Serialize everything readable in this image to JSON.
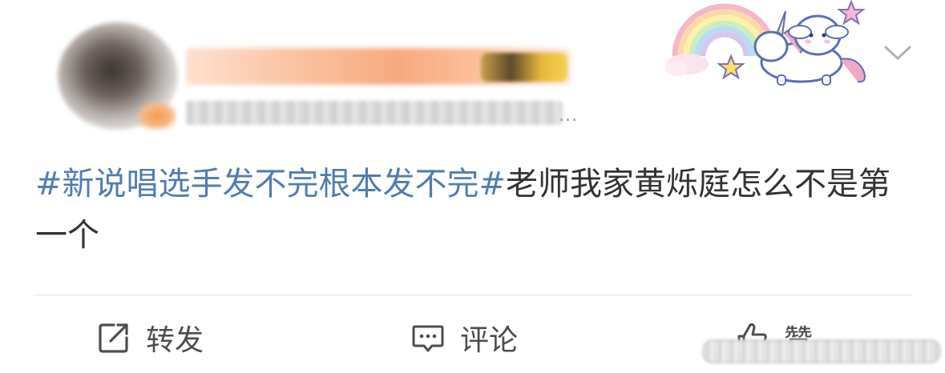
{
  "header": {
    "avatar_icon": "avatar-blurred",
    "username": "",
    "meta": "",
    "meta_ellipsis": "...",
    "decoration_icon": "rainbow-unicorn-sticker-icon",
    "menu_icon": "chevron-down-icon"
  },
  "post": {
    "hashtag": "#新说唱选手发不完根本发不完#",
    "text": "老师我家黄烁庭怎么不是第一个"
  },
  "actions": {
    "repost": {
      "icon": "repost-icon",
      "label": "转发"
    },
    "comment": {
      "icon": "comment-icon",
      "label": "评论"
    },
    "like": {
      "icon": "thumbs-up-icon",
      "label": "赞"
    }
  },
  "colors": {
    "hashtag": "#507daf",
    "text": "#333333",
    "action_text": "#4d4d4d",
    "divider": "#e6e6e6"
  }
}
